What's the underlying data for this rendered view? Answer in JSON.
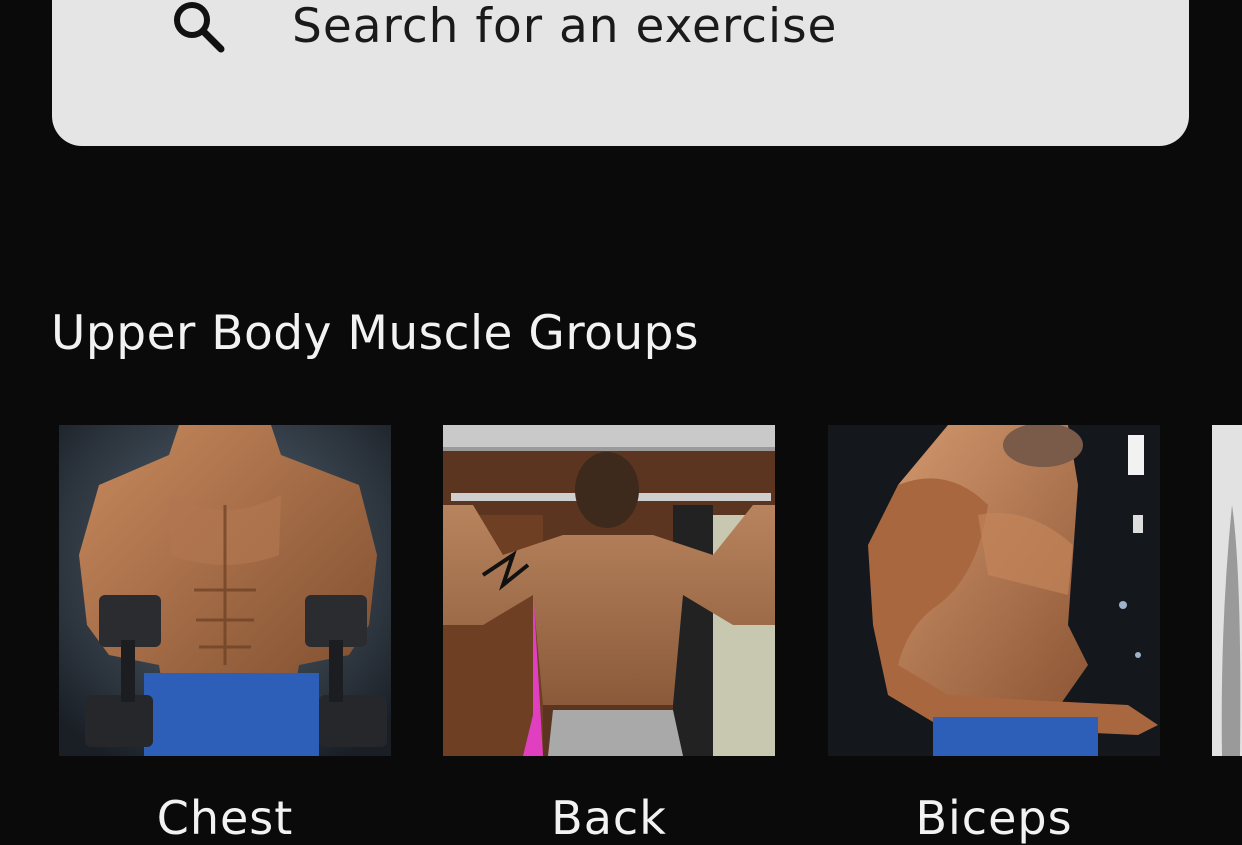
{
  "search": {
    "placeholder": "Search for an exercise",
    "icon": "search-icon"
  },
  "section": {
    "title": "Upper Body Muscle Groups"
  },
  "muscle_groups": [
    {
      "label": "Chest",
      "image": "chest-photo"
    },
    {
      "label": "Back",
      "image": "back-photo"
    },
    {
      "label": "Biceps",
      "image": "biceps-photo"
    }
  ],
  "colors": {
    "background": "#0a0a0a",
    "search_background": "#e5e5e5",
    "text": "#f2f2f2"
  }
}
